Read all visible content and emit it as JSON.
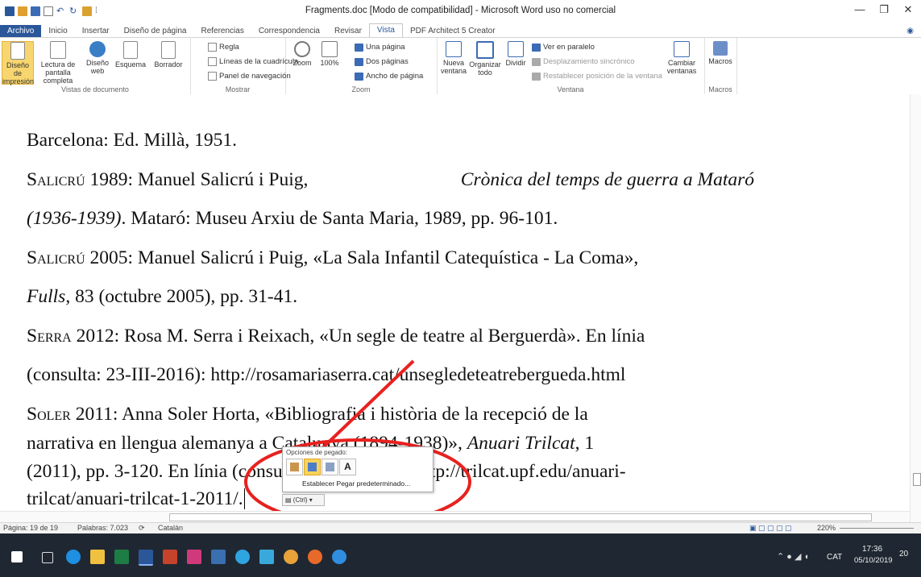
{
  "window": {
    "title": "Fragments.doc [Modo de compatibilidad]  -  Microsoft Word uso no comercial",
    "minimize": "—",
    "restore": "❐",
    "close": "✕"
  },
  "tabs": [
    "Archivo",
    "Inicio",
    "Insertar",
    "Diseño de página",
    "Referencias",
    "Correspondencia",
    "Revisar",
    "Vista",
    "PDF Architect 5 Creator"
  ],
  "ribbon": {
    "groups": {
      "vistas": "Vistas de documento",
      "mostrar": "Mostrar",
      "zoom": "Zoom",
      "ventana": "Ventana",
      "macros": "Macros"
    },
    "vistas_buttons": [
      "Diseño de impresión",
      "Lectura de pantalla completa",
      "Diseño web",
      "Esquema",
      "Borrador"
    ],
    "mostrar": [
      "Regla",
      "Líneas de la cuadrícula",
      "Panel de navegación"
    ],
    "zoom_buttons": [
      "Zoom",
      "100%"
    ],
    "zoom_small": [
      "Una página",
      "Dos páginas",
      "Ancho de página"
    ],
    "ventana_buttons": [
      "Nueva ventana",
      "Organizar todo",
      "Dividir"
    ],
    "ventana_small": [
      "Ver en paralelo",
      "Desplazamiento sincrónico",
      "Restablecer posición de la ventana"
    ],
    "cambiar": "Cambiar ventanas",
    "macros": "Macros"
  },
  "document": {
    "l1": "Barcelona: Ed. Millà, 1951.",
    "l2a": "Salicrú",
    "l2b": " 1989: Manuel Salicrú i Puig, ",
    "l2c": "Crònica del temps de guerra a Mataró",
    "l3a": "(1936-1939)",
    "l3b": ". Mataró: Museu Arxiu de Santa Maria, 1989, pp. 96-101.",
    "l4a": "Salicrú",
    "l4b": " 2005: Manuel Salicrú i Puig, «La Sala Infantil Catequística - La Coma»,",
    "l5a": "Fulls",
    "l5b": ", 83 (octubre 2005), pp. 31-41.",
    "l6a": "Serra",
    "l6b": " 2012: Rosa M. Serra i Reixach, «Un segle de teatre al Berguerdà». En línia",
    "l7": "(consulta: 23-III-2016): http://rosamariaserra.cat/unsegledeteatrebergueda.html",
    "l8a": "Soler",
    "l8b": " 2011: Anna Soler Horta, «Bibliografia i història de la recepció de la",
    "l9a": "narrativa en llengua alemanya a Catalunya (1894-1938)», ",
    "l9b": "Anuari Trilcat",
    "l9c": ", 1",
    "l10": "(2011), pp. 3-120. En línia (consulta: 20-IV-2016): http://trilcat.upf.edu/anuari-",
    "l11": "trilcat/anuari-trilcat-1-2011/."
  },
  "paste_popup": {
    "title": "Opciones de pegado:",
    "default_label": "Establecer Pegar predeterminado...",
    "ctrl": "(Ctrl) ▾"
  },
  "status": {
    "page": "Página: 19 de 19",
    "words": "Palabras: 7.023",
    "language": "Catalán",
    "zoom": "220%"
  },
  "taskbar": {
    "language": "CAT",
    "time": "17:36",
    "date": "05/10/2019",
    "notifications": "20"
  },
  "colors": {
    "word_blue": "#2b579a",
    "annotation_red": "#e8211f",
    "taskbar": "#1f2832"
  }
}
